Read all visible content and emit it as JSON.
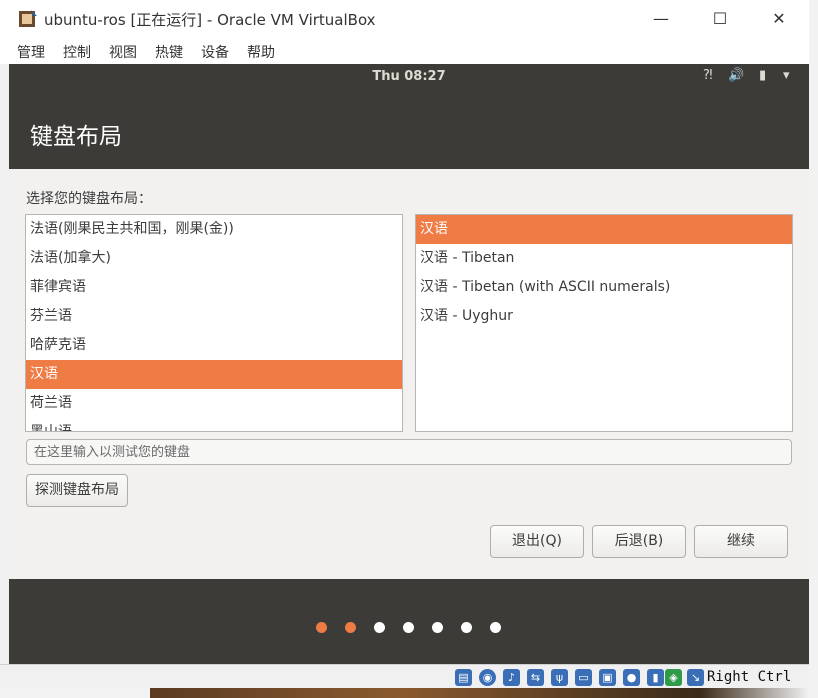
{
  "window": {
    "title": "ubuntu-ros [正在运行] - Oracle VM VirtualBox",
    "minimize": "—",
    "maximize": "☐",
    "close": "✕"
  },
  "menu": [
    "管理",
    "控制",
    "视图",
    "热键",
    "设备",
    "帮助"
  ],
  "topbar": {
    "clock": "Thu 08:27",
    "icons": [
      "network-icon",
      "volume-icon",
      "battery-icon",
      "dropdown-arrow-icon"
    ]
  },
  "installer": {
    "title": "键盘布局",
    "prompt": "选择您的键盘布局：",
    "layouts": [
      "法语(刚果民主共和国，刚果(金))",
      "法语(加拿大)",
      "菲律宾语",
      "芬兰语",
      "哈萨克语",
      "汉语",
      "荷兰语",
      "黑山语"
    ],
    "selected_layout": "汉语",
    "variants": [
      "汉语",
      "汉语 - Tibetan",
      "汉语 - Tibetan (with ASCII numerals)",
      "汉语 - Uyghur"
    ],
    "selected_variant": "汉语",
    "test_placeholder": "在这里输入以测试您的键盘",
    "detect_button": "探测键盘布局",
    "quit_button": "退出(Q)",
    "back_button": "后退(B)",
    "continue_button": "继续",
    "progress": {
      "total_steps": 7,
      "completed_steps": 2
    }
  },
  "statusbar": {
    "host_key": "Right Ctrl"
  },
  "colors": {
    "accent": "#ef7b45",
    "header": "#3c3b37",
    "background": "#f2f1f0"
  }
}
